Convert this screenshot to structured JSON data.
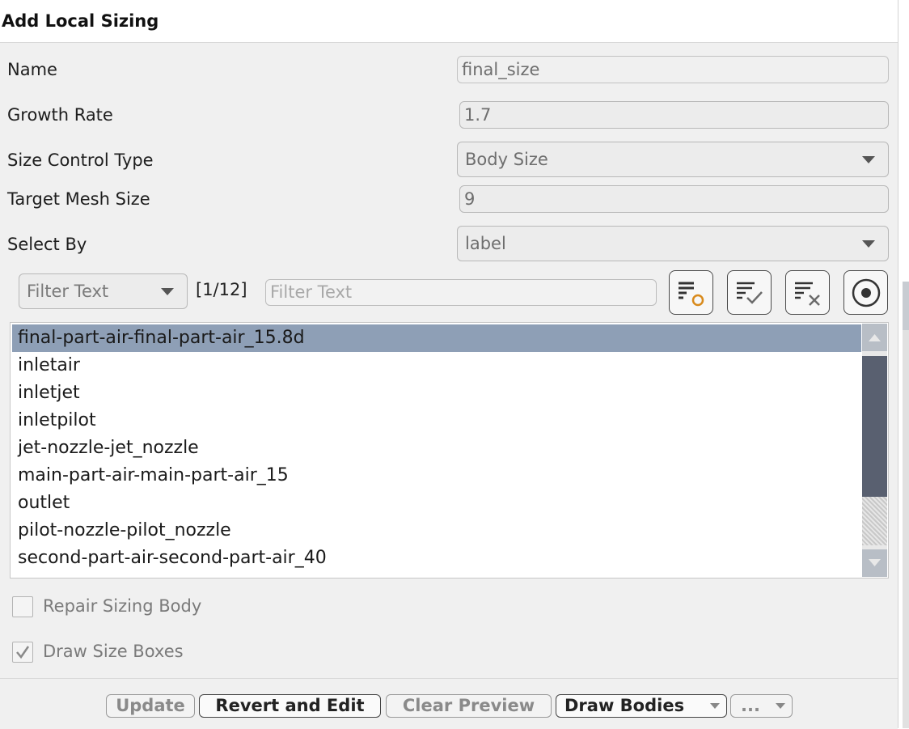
{
  "dialog": {
    "title": "Add Local Sizing"
  },
  "form": {
    "name_label": "Name",
    "name_value": "final_size",
    "growth_rate_label": "Growth Rate",
    "growth_rate_value": "1.7",
    "size_control_type_label": "Size Control Type",
    "size_control_type_value": "Body Size",
    "target_mesh_size_label": "Target Mesh Size",
    "target_mesh_size_value": "9",
    "select_by_label": "Select By",
    "select_by_value": "label"
  },
  "filter": {
    "mode_value": "Filter Text",
    "count": "[1/12]",
    "placeholder": "Filter Text",
    "tools": [
      "filter-options-icon",
      "select-all-icon",
      "deselect-all-icon",
      "circle-select-icon"
    ]
  },
  "list": {
    "items": [
      "final-part-air-final-part-air_15.8d",
      "inletair",
      "inletjet",
      "inletpilot",
      "jet-nozzle-jet_nozzle",
      "main-part-air-main-part-air_15",
      "outlet",
      "pilot-nozzle-pilot_nozzle",
      "second-part-air-second-part-air_40"
    ],
    "selected_index": 0
  },
  "options": {
    "repair_label": "Repair Sizing Body",
    "repair_checked": false,
    "draw_boxes_label": "Draw Size Boxes",
    "draw_boxes_checked": true
  },
  "buttons": {
    "update": "Update",
    "revert": "Revert and Edit",
    "clear_preview": "Clear Preview",
    "draw_bodies": "Draw Bodies",
    "more": "..."
  },
  "colors": {
    "selection": "#8e9fb6",
    "scroll_thumb": "#596070",
    "accent_icon": "#d88a1c"
  }
}
